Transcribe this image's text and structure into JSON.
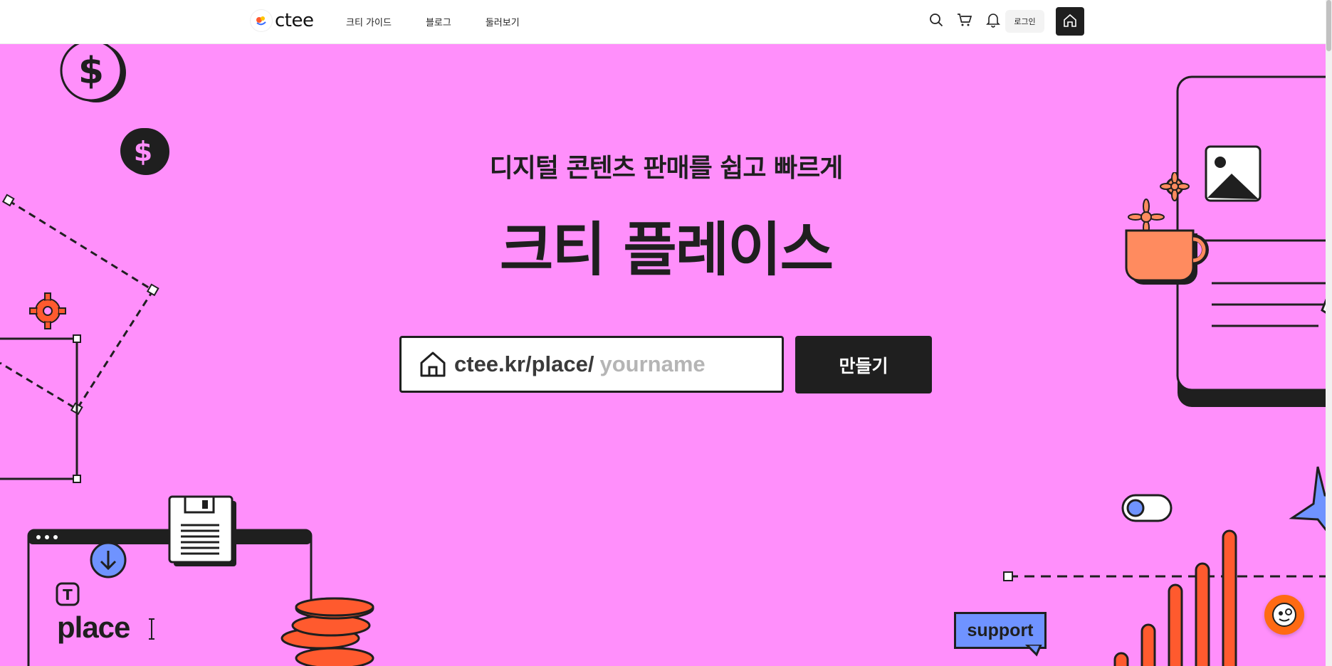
{
  "header": {
    "logo_text": "ctee",
    "nav": [
      "크티 가이드",
      "블로그",
      "둘러보기"
    ],
    "login_label": "로그인"
  },
  "hero": {
    "subtitle": "디지털 콘텐츠 판매를 쉽고 빠르게",
    "title": "크티 플레이스",
    "url_prefix": "ctee.kr/place/",
    "url_placeholder": "yourname",
    "create_label": "만들기"
  },
  "decorations": {
    "place_label": "place",
    "support_label": "support",
    "dollar_symbol": "$",
    "text_tool_letter": "T"
  },
  "colors": {
    "background": "#ff8ffb",
    "dark": "#1f1f1f",
    "accent_orange": "#ff5a2e",
    "accent_blue": "#6f93ff"
  }
}
